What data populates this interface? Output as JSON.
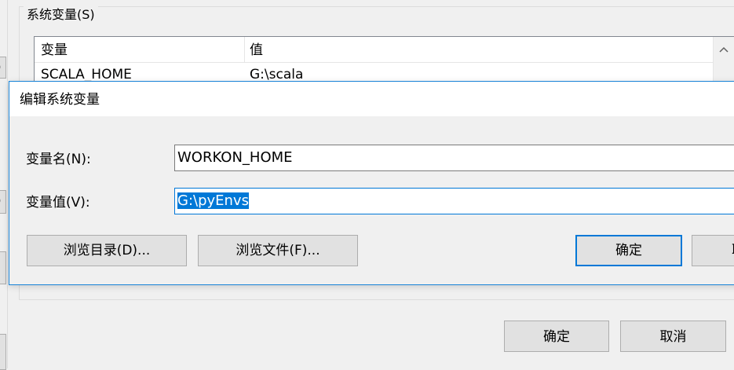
{
  "system_vars": {
    "group_title": "系统变量(S)",
    "columns": [
      "变量",
      "值"
    ],
    "rows": [
      {
        "name": "SCALA_HOME",
        "value": "G:\\scala"
      }
    ],
    "scroll_up_icon": "chevron-up-icon"
  },
  "left_edge_buttons": [
    ")",
    ")"
  ],
  "main_buttons": {
    "ok_label": "确定",
    "cancel_label": "取消"
  },
  "dialog": {
    "title": "编辑系统变量",
    "name_label": "变量名(N):",
    "name_value": "WORKON_HOME",
    "value_label": "变量值(V):",
    "value_value": "G:\\pyEnvs",
    "browse_dir_label": "浏览目录(D)...",
    "browse_file_label": "浏览文件(F)...",
    "ok_label": "确定",
    "cancel_label": "取"
  },
  "colors": {
    "accent": "#0078d7",
    "window_bg": "#f0f0f0",
    "button_bg": "#e1e1e1"
  }
}
